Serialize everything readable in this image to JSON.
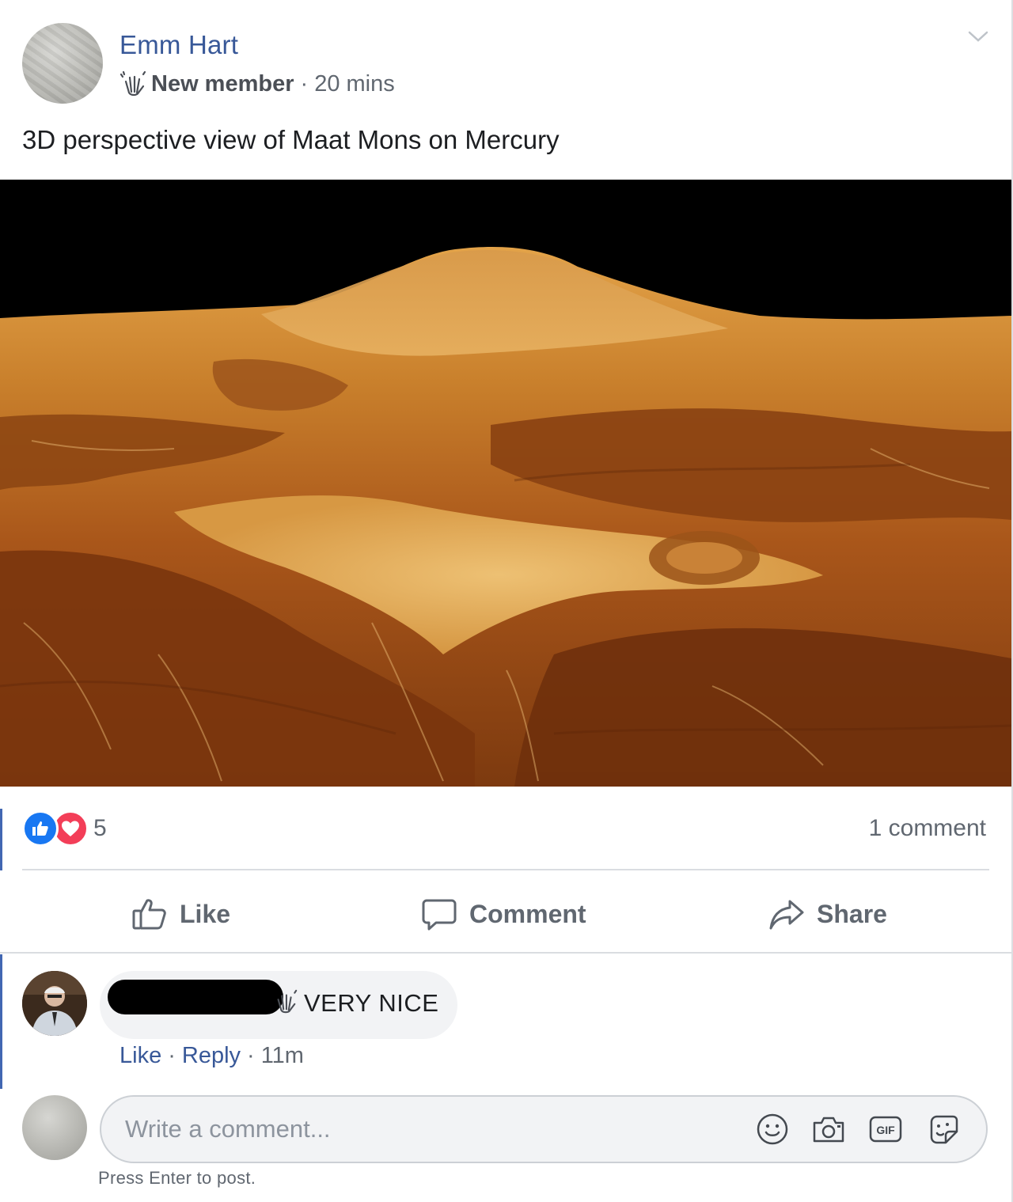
{
  "post": {
    "author": "Emm Hart",
    "badge": "New member",
    "separator": "·",
    "time": "20 mins",
    "text": "3D perspective view of Maat Mons on Mercury",
    "photo_icon": "volcano-landscape-photo"
  },
  "reactions": {
    "count": "5",
    "types": [
      "like",
      "love"
    ],
    "comment_count": "1 comment"
  },
  "actions": {
    "like": "Like",
    "comment": "Comment",
    "share": "Share"
  },
  "comment": {
    "text": "VERY NICE",
    "like_label": "Like",
    "reply_label": "Reply",
    "dot": "·",
    "time": "11m"
  },
  "composer": {
    "placeholder": "Write a comment...",
    "hint": "Press Enter to post.",
    "icons": [
      "emoji-icon",
      "camera-icon",
      "gif-icon",
      "sticker-icon"
    ]
  },
  "colors": {
    "link_blue": "#385898",
    "like_blue": "#1877f2",
    "love_red": "#f33e58",
    "secondary_text": "#606770"
  }
}
